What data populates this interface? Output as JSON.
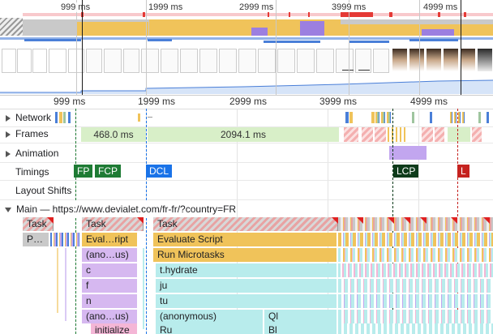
{
  "overview": {
    "time_labels": [
      "999 ms",
      "1999 ms",
      "2999 ms",
      "3999 ms",
      "4999 ms"
    ]
  },
  "ruler": {
    "time_labels": [
      "999 ms",
      "1999 ms",
      "2999 ms",
      "3999 ms",
      "4999 ms"
    ]
  },
  "tracks": {
    "network": "Network",
    "frames": "Frames",
    "animation": "Animation",
    "timings": "Timings",
    "layout_shifts": "Layout Shifts",
    "main": "Main — https://www.devialet.com/fr-fr/?country=FR"
  },
  "frames": {
    "frame1": "468.0 ms",
    "frame2": "2094.1 ms"
  },
  "timings": {
    "fp": "FP",
    "fcp": "FCP",
    "dcl": "DCL",
    "lcp": "LCP",
    "l": "L"
  },
  "colors": {
    "fp": "#1e7b34",
    "fcp": "#1e7b34",
    "dcl": "#1a73e8",
    "lcp": "#0d3b1a",
    "l": "#c5221f"
  },
  "flame": {
    "row1": [
      "Task",
      "Task",
      "Task"
    ],
    "row2": [
      "P…",
      "Eval…ript",
      "Evaluate Script"
    ],
    "row3": [
      "(ano…us)",
      "Run Microtasks"
    ],
    "row4": [
      "c",
      "t.hydrate"
    ],
    "row5": [
      "f",
      "ju"
    ],
    "row6": [
      "n",
      "tu"
    ],
    "row7": [
      "(ano…us)",
      "(anonymous)",
      "Ql"
    ],
    "row8": [
      "initialize",
      "Ru",
      "Bl"
    ]
  }
}
